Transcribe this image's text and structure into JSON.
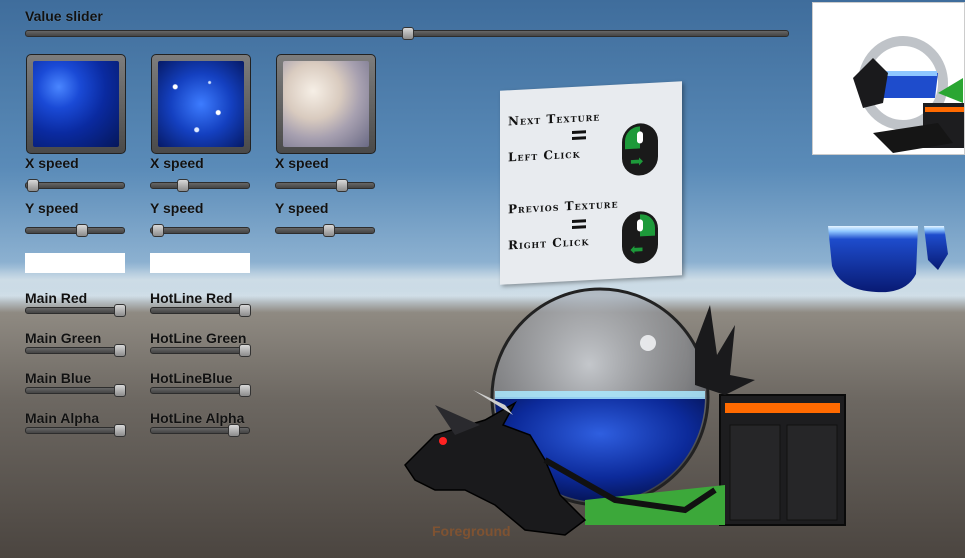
{
  "value_slider": {
    "label": "Value slider",
    "value": 0.5
  },
  "textures": [
    {
      "name": "blue-nebula",
      "x_speed": {
        "label": "X speed",
        "value": 0.05
      },
      "y_speed": {
        "label": "Y speed",
        "value": 0.55
      }
    },
    {
      "name": "starfield",
      "x_speed": {
        "label": "X speed",
        "value": 0.3
      },
      "y_speed": {
        "label": "Y speed",
        "value": 0.05
      }
    },
    {
      "name": "cloudy-nebula",
      "x_speed": {
        "label": "X speed",
        "value": 0.65
      },
      "y_speed": {
        "label": "Y speed",
        "value": 0.5
      }
    }
  ],
  "main_colors": [
    {
      "label": "Main Red",
      "value": 0.95
    },
    {
      "label": "Main Green",
      "value": 0.95
    },
    {
      "label": "Main Blue",
      "value": 0.95
    },
    {
      "label": "Main Alpha",
      "value": 0.95
    }
  ],
  "hotline_colors": [
    {
      "label": "HotLine Red",
      "value": 0.95
    },
    {
      "label": "HotLine Green",
      "value": 0.95
    },
    {
      "label": "HotLineBlue",
      "value": 0.95
    },
    {
      "label": "HotLine Alpha",
      "value": 0.83
    }
  ],
  "sign": {
    "line1": "Next Texture",
    "line2": "Left Click",
    "line3": "Previos Texture",
    "line4": "Right Click"
  },
  "footer": {
    "foreground_label": "Foreground"
  },
  "colors": {
    "accent_green": "#1d9a3a",
    "sky_blue": "#5a8bb8"
  }
}
